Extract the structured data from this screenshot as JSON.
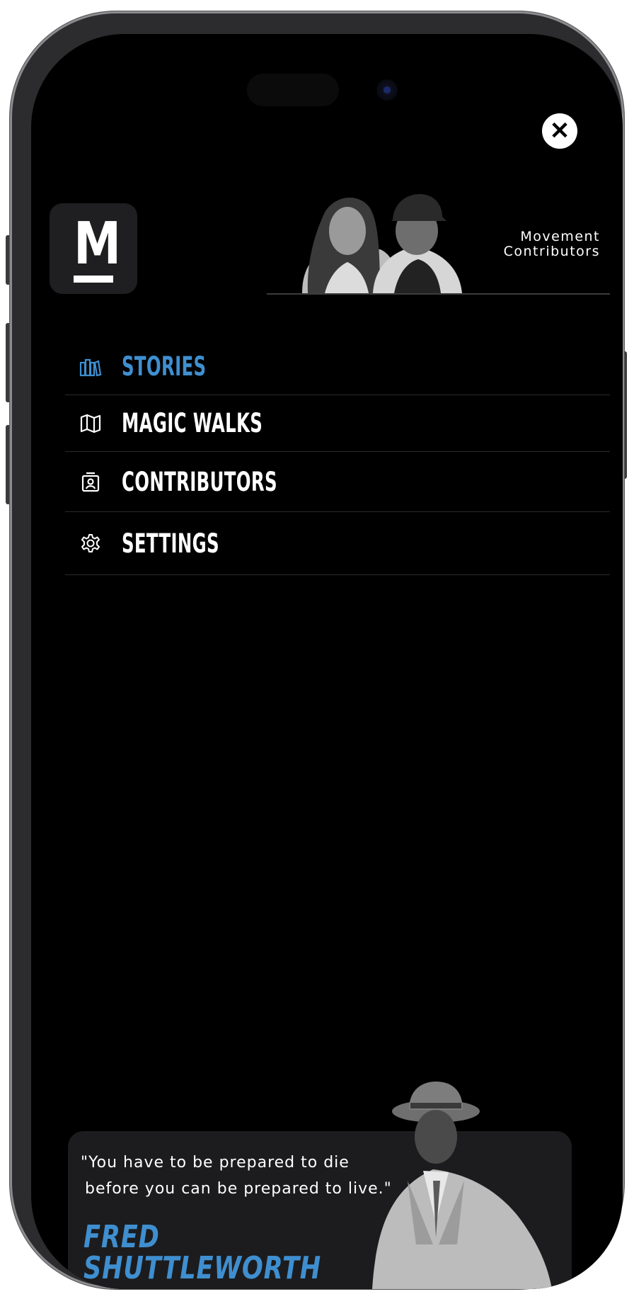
{
  "header": {
    "close_icon": "close-icon",
    "logo_letter": "M"
  },
  "contributors_banner": {
    "title_line1": "Movement",
    "title_line2": "Contributors"
  },
  "menu": {
    "items": [
      {
        "label": "STORIES",
        "icon": "books-icon",
        "active": true,
        "color": "#3f8fd0"
      },
      {
        "label": "MAGIC WALKS",
        "icon": "map-icon",
        "active": false
      },
      {
        "label": "CONTRIBUTORS",
        "icon": "contact-badge-icon",
        "active": false
      },
      {
        "label": "SETTINGS",
        "icon": "gear-icon",
        "active": false
      }
    ]
  },
  "quote_card": {
    "line1": "\"You have to be prepared to die",
    "line2": "before you can be prepared to live.\"",
    "name_line1": "FRED",
    "name_line2": "SHUTTLEWORTH",
    "accent_color": "#3f8fd0"
  }
}
